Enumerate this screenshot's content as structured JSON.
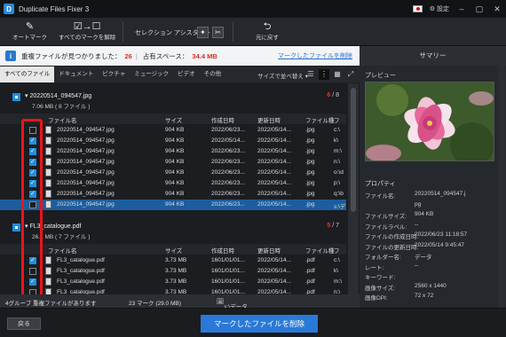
{
  "titlebar": {
    "title": "Duplicate Files Fixer 3",
    "settings": "設定"
  },
  "toolbar": {
    "automark": "オートマーク",
    "unmark_all": "すべてのマークを解除",
    "selection_assistant": "セレクション アシスタント",
    "undo": "元に戻す"
  },
  "infobar": {
    "dupes_label": "重複ファイルが見つかりました：",
    "dupes_count": "26",
    "space_label": "占有スペース：",
    "space_value": "34.4 MB",
    "delete_marked_link": "マークしたファイルを削除"
  },
  "summary": {
    "title": "サマリー",
    "preview_label": "プレビュー"
  },
  "tabs": [
    "すべてのファイル",
    "ドキュメント",
    "ピクチャ",
    "ミュージック",
    "ビデオ",
    "その他"
  ],
  "sort_label": "サイズで並べ替え ▾",
  "columns": [
    "ファイル名",
    "サイズ",
    "作成日時",
    "更新日時",
    "ファイル種",
    "フ"
  ],
  "groups": [
    {
      "name": "20220514_094547.jpg",
      "size": "7.06 MB  ( 8 ファイル )",
      "marked": "6",
      "total": " / 8",
      "rows": [
        {
          "name": "20220514_094547.jpg",
          "size": "904 KB",
          "created": "2022/06/23...",
          "modified": "2022/05/14...",
          "type": ".jpg",
          "path": "c:\\",
          "checked": false
        },
        {
          "name": "20220514_094547.jpg",
          "size": "904 KB",
          "created": "2022/05/14...",
          "modified": "2022/05/14...",
          "type": ".jpg",
          "path": "k\\",
          "checked": true
        },
        {
          "name": "20220514_094547.jpg",
          "size": "904 KB",
          "created": "2022/06/23...",
          "modified": "2022/05/14...",
          "type": ".jpg",
          "path": "m:\\",
          "checked": true
        },
        {
          "name": "20220514_094547.jpg",
          "size": "904 KB",
          "created": "2022/06/23...",
          "modified": "2022/05/14...",
          "type": ".jpg",
          "path": "n:\\",
          "checked": true
        },
        {
          "name": "20220514_094547.jpg",
          "size": "904 KB",
          "created": "2022/06/23...",
          "modified": "2022/05/14...",
          "type": ".jpg",
          "path": "o:\\d",
          "checked": true
        },
        {
          "name": "20220514_094547.jpg",
          "size": "904 KB",
          "created": "2022/06/23...",
          "modified": "2022/05/14...",
          "type": ".jpg",
          "path": "p:\\",
          "checked": true
        },
        {
          "name": "20220514_094547.jpg",
          "size": "904 KB",
          "created": "2022/06/23...",
          "modified": "2022/05/14...",
          "type": ".jpg",
          "path": "q:\\b",
          "checked": true
        },
        {
          "name": "20220514_094547.jpg",
          "size": "904 KB",
          "created": "2022/06/23...",
          "modified": "2022/05/14...",
          "type": ".jpg",
          "path": "s:\\デ",
          "checked": false,
          "selected": true
        }
      ]
    },
    {
      "name": "FL3_catalogue.pdf",
      "size": "26.1 MB  ( 7 ファイル )",
      "marked": "5",
      "total": " / 7",
      "rows": [
        {
          "name": "FL3_catalogue.pdf",
          "size": "3.73 MB",
          "created": "1601/01/01...",
          "modified": "2022/05/14...",
          "type": ".pdf",
          "path": "c:\\",
          "checked": true
        },
        {
          "name": "FL3_catalogue.pdf",
          "size": "3.73 MB",
          "created": "1601/01/01...",
          "modified": "2022/05/14...",
          "type": ".pdf",
          "path": "k\\",
          "checked": false
        },
        {
          "name": "FL3_catalogue.pdf",
          "size": "3.73 MB",
          "created": "1601/01/01...",
          "modified": "2022/05/14...",
          "type": ".pdf",
          "path": "m:\\",
          "checked": true
        },
        {
          "name": "FL3_catalogue.pdf",
          "size": "3.73 MB",
          "created": "1601/01/01...",
          "modified": "2022/05/14...",
          "type": ".pdf",
          "path": "n:\\",
          "checked": false
        }
      ]
    }
  ],
  "statusbar": {
    "groups": "4グループ 重複ファイルがあります",
    "selected": "23 マーク (29.0 MB)",
    "path": "s:\\データ\\20220514_094547.jpg"
  },
  "properties": {
    "title": "プロパティ",
    "items": [
      {
        "k": "ファイル名:",
        "v": "20220514_094547.j"
      },
      {
        "k": "",
        "v": "pg"
      },
      {
        "k": "ファイルサイズ:",
        "v": "904 KB"
      },
      {
        "k": "ファイルラベル:",
        "v": "--"
      },
      {
        "k": "ファイルの作成日時:",
        "v": "2022/06/23 11:18:57"
      },
      {
        "k": "ファイルの更新日時:",
        "v": "2022/05/14 9:45:47"
      },
      {
        "k": "フォルダー名:",
        "v": "データ"
      },
      {
        "k": "レート:",
        "v": "--"
      },
      {
        "k": "キーワード:",
        "v": ""
      },
      {
        "k": "画像サイズ:",
        "v": "2560 x 1440"
      },
      {
        "k": "画像DPI:",
        "v": "72 x 72"
      }
    ]
  },
  "bottom": {
    "back": "戻る",
    "delete_marked": "マークしたファイルを削除"
  }
}
